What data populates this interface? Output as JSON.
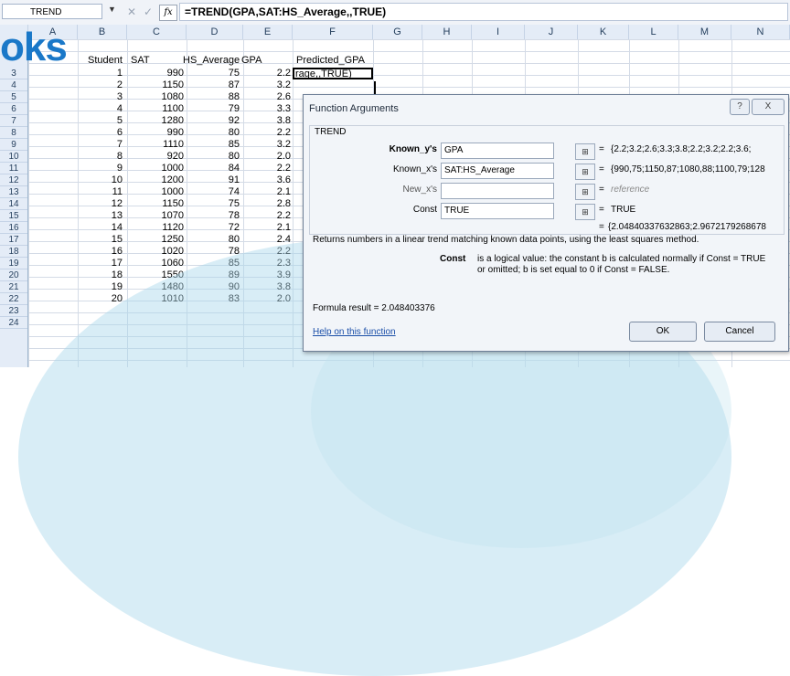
{
  "formula_bar": {
    "name_box": "TREND",
    "dropdown_glyph": "▼",
    "cancel_glyph": "✕",
    "enter_glyph": "✓",
    "fx_label": "fx",
    "formula": "=TREND(GPA,SAT:HS_Average,,TRUE)"
  },
  "watermark": "oks",
  "columns": [
    "A",
    "B",
    "C",
    "D",
    "E",
    "F",
    "G",
    "H",
    "I",
    "J",
    "K",
    "L",
    "M",
    "N"
  ],
  "rows": [
    "3",
    "4",
    "5",
    "6",
    "7",
    "8",
    "9",
    "10",
    "11",
    "12",
    "13",
    "14",
    "15",
    "16",
    "17",
    "18",
    "19",
    "20",
    "21",
    "22",
    "23",
    "24"
  ],
  "headers": {
    "student": "Student",
    "sat": "SAT",
    "hs_average": "HS_Average",
    "gpa": "GPA",
    "predicted_gpa": "Predicted_GPA"
  },
  "active_cell_text": "rage,,TRUE)",
  "table": [
    {
      "student": "1",
      "sat": "990",
      "hs": "75",
      "gpa": "2.2"
    },
    {
      "student": "2",
      "sat": "1150",
      "hs": "87",
      "gpa": "3.2"
    },
    {
      "student": "3",
      "sat": "1080",
      "hs": "88",
      "gpa": "2.6"
    },
    {
      "student": "4",
      "sat": "1100",
      "hs": "79",
      "gpa": "3.3"
    },
    {
      "student": "5",
      "sat": "1280",
      "hs": "92",
      "gpa": "3.8"
    },
    {
      "student": "6",
      "sat": "990",
      "hs": "80",
      "gpa": "2.2"
    },
    {
      "student": "7",
      "sat": "1110",
      "hs": "85",
      "gpa": "3.2"
    },
    {
      "student": "8",
      "sat": "920",
      "hs": "80",
      "gpa": "2.0"
    },
    {
      "student": "9",
      "sat": "1000",
      "hs": "84",
      "gpa": "2.2"
    },
    {
      "student": "10",
      "sat": "1200",
      "hs": "91",
      "gpa": "3.6"
    },
    {
      "student": "11",
      "sat": "1000",
      "hs": "74",
      "gpa": "2.1"
    },
    {
      "student": "12",
      "sat": "1150",
      "hs": "75",
      "gpa": "2.8"
    },
    {
      "student": "13",
      "sat": "1070",
      "hs": "78",
      "gpa": "2.2"
    },
    {
      "student": "14",
      "sat": "1120",
      "hs": "72",
      "gpa": "2.1"
    },
    {
      "student": "15",
      "sat": "1250",
      "hs": "80",
      "gpa": "2.4"
    },
    {
      "student": "16",
      "sat": "1020",
      "hs": "78",
      "gpa": "2.2"
    },
    {
      "student": "17",
      "sat": "1060",
      "hs": "85",
      "gpa": "2.3"
    },
    {
      "student": "18",
      "sat": "1550",
      "hs": "89",
      "gpa": "3.9"
    },
    {
      "student": "19",
      "sat": "1480",
      "hs": "90",
      "gpa": "3.8"
    },
    {
      "student": "20",
      "sat": "1010",
      "hs": "83",
      "gpa": "2.0"
    }
  ],
  "dialog": {
    "title": "Function Arguments",
    "help_glyph": "?",
    "close_glyph": "X",
    "function_name": "TREND",
    "args": [
      {
        "label": "Known_y's",
        "value": "GPA",
        "result": "{2.2;3.2;2.6;3.3;3.8;2.2;3.2;2.2;3.6;",
        "bold": true
      },
      {
        "label": "Known_x's",
        "value": "SAT:HS_Average",
        "result": "{990,75;1150,87;1080,88;1100,79;128",
        "bold": false
      },
      {
        "label": "New_x's",
        "value": "",
        "result": "reference",
        "bold": false
      },
      {
        "label": "Const",
        "value": "TRUE",
        "result": "TRUE",
        "bold": false
      }
    ],
    "ref_glyph": "⊞",
    "eq": "=",
    "overall_result": "{2.04840337632863;2.9672179268678",
    "description": "Returns numbers in a linear trend matching known data points, using the least squares method.",
    "arg_desc_name": "Const",
    "arg_desc_text": "is a logical value: the constant b is calculated normally if Const = TRUE or omitted; b is set equal to 0 if Const = FALSE.",
    "formula_result": "Formula result =  2.048403376",
    "help_link": "Help on this function",
    "ok": "OK",
    "cancel": "Cancel"
  },
  "colors": {
    "accent": "#1a78c8",
    "overlay": "#a8d7ea",
    "dialog_bg": "#f2f5f9"
  }
}
